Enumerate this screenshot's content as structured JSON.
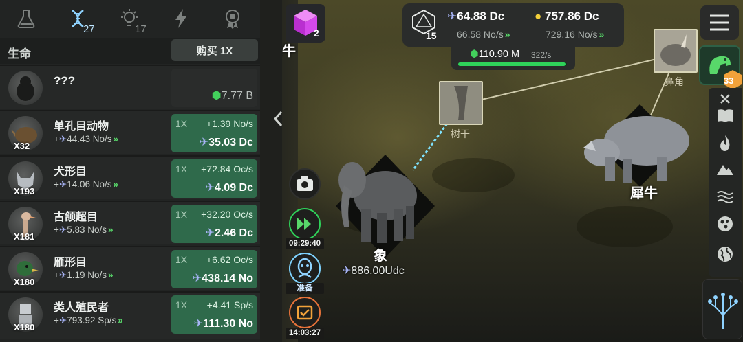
{
  "tabs": [
    {
      "name": "science",
      "count": ""
    },
    {
      "name": "dna",
      "count": "27"
    },
    {
      "name": "idea",
      "count": "17"
    },
    {
      "name": "energy",
      "count": ""
    },
    {
      "name": "achievement",
      "count": ""
    }
  ],
  "panel": {
    "title": "生命",
    "buy_mode": "购买 1X",
    "locked": {
      "name": "???",
      "price": "7.77 B"
    },
    "rows": [
      {
        "name": "单孔目动物",
        "mult": "X32",
        "rate": "44.43 No/s",
        "level": "1X",
        "gain": "+1.39 No/s",
        "cost": "35.03 Dc"
      },
      {
        "name": "犬形目",
        "mult": "X193",
        "rate": "14.06 No/s",
        "level": "1X",
        "gain": "+72.84 Oc/s",
        "cost": "4.09 Dc"
      },
      {
        "name": "古颌超目",
        "mult": "X181",
        "rate": "5.83 No/s",
        "level": "1X",
        "gain": "+32.20 Oc/s",
        "cost": "2.46 Dc"
      },
      {
        "name": "雁形目",
        "mult": "X180",
        "rate": "1.19 No/s",
        "level": "1X",
        "gain": "+6.62 Oc/s",
        "cost": "438.14 No"
      },
      {
        "name": "类人殖民者",
        "mult": "X180",
        "rate": "793.92 Sp/s",
        "level": "1X",
        "gain": "+4.41 Sp/s",
        "cost": "111.30 No"
      }
    ]
  },
  "hud": {
    "cube_count": "2",
    "dice_count": "15",
    "entropy": "64.88 Dc",
    "entropy_rate": "66.58 No/s",
    "ideas": "757.86 Dc",
    "ideas_rate": "729.16 No/s",
    "population": "110.90 M",
    "population_rate": "322/s",
    "population_fill": 0.99
  },
  "side": {
    "boost_timer": "09:29:40",
    "ready_label": "准备",
    "task_timer": "14:03:27"
  },
  "right": {
    "dino_count": "33"
  },
  "map": {
    "edge_label": "水牛",
    "trunk_label": "树干",
    "horn_label": "鼻角",
    "elephant_label": "象",
    "elephant_value": "886.00Udc",
    "rhino_label": "犀牛"
  },
  "colors": {
    "accent_green": "#2fd25a",
    "buy_button": "#2f6a4b",
    "entropy_blue": "#a7b4f5",
    "idea_yellow": "#f2cf3a"
  }
}
